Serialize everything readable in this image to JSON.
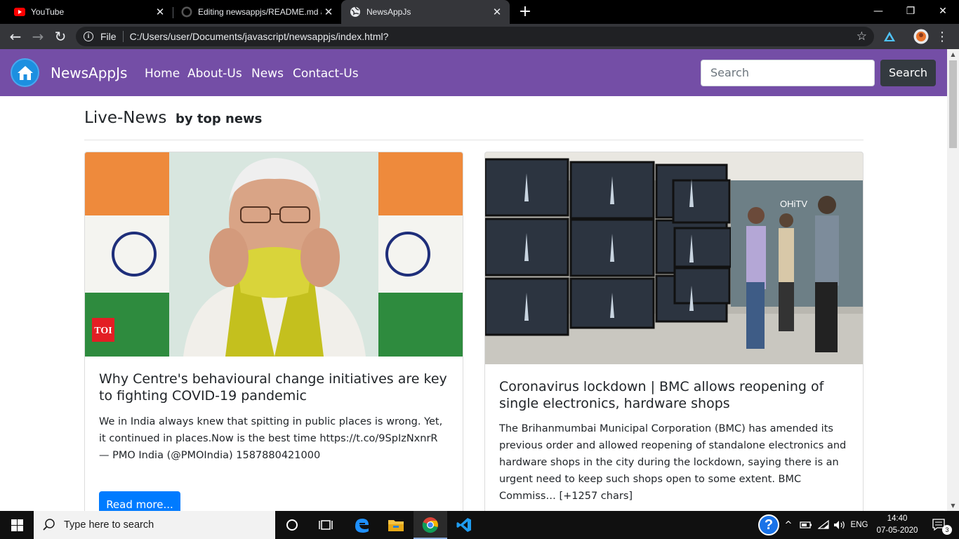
{
  "browser": {
    "tabs": [
      {
        "title": "YouTube",
        "icon": "youtube-icon",
        "active": false
      },
      {
        "title": "Editing newsappjs/README.md a",
        "icon": "github-icon",
        "active": false
      },
      {
        "title": "NewsAppJs",
        "icon": "globe-icon",
        "active": true
      }
    ],
    "new_tab_symbol": "+",
    "window_controls": {
      "minimize": "—",
      "restore": "❐",
      "close": "✕"
    },
    "toolbar": {
      "back": "←",
      "forward": "→",
      "reload": "↻",
      "page_info": "i",
      "scheme_label": "File",
      "url": "C:/Users/user/Documents/javascript/newsappjs/index.html?",
      "bookmark_star": "☆"
    }
  },
  "navbar": {
    "brand": "NewsAppJs",
    "links": [
      "Home",
      "About-Us",
      "News",
      "Contact-Us"
    ],
    "search_placeholder": "Search",
    "search_button": "Search",
    "bg_color": "#744ea6"
  },
  "main": {
    "heading": "Live-News",
    "subheading": "by top news",
    "articles": [
      {
        "image_badge": "TOI",
        "title": "Why Centre's behavioural change initiatives are key to fighting COVID-19 pandemic",
        "description": "We in India always knew that spitting in public places is wrong. Yet, it continued in places.Now is the best time https://t.co/9SpIzNxnrR — PMO India (@PMOIndia) 1587880421000",
        "button": "Read more..."
      },
      {
        "title": "Coronavirus lockdown | BMC allows reopening of single electronics, hardware shops",
        "description": "The Brihanmumbai Municipal Corporation (BMC) has amended its previous order and allowed reopening of standalone electronics and hardware shops in the city during the lockdown, saying there is an urgent need to keep such shops open to some extent. BMC Commiss… [+1257 chars]"
      }
    ]
  },
  "taskbar": {
    "search_placeholder": "Type here to search",
    "language": "ENG",
    "time": "14:40",
    "date": "07-05-2020",
    "notification_count": "3",
    "help_symbol": "?",
    "overflow_symbol": "^"
  }
}
